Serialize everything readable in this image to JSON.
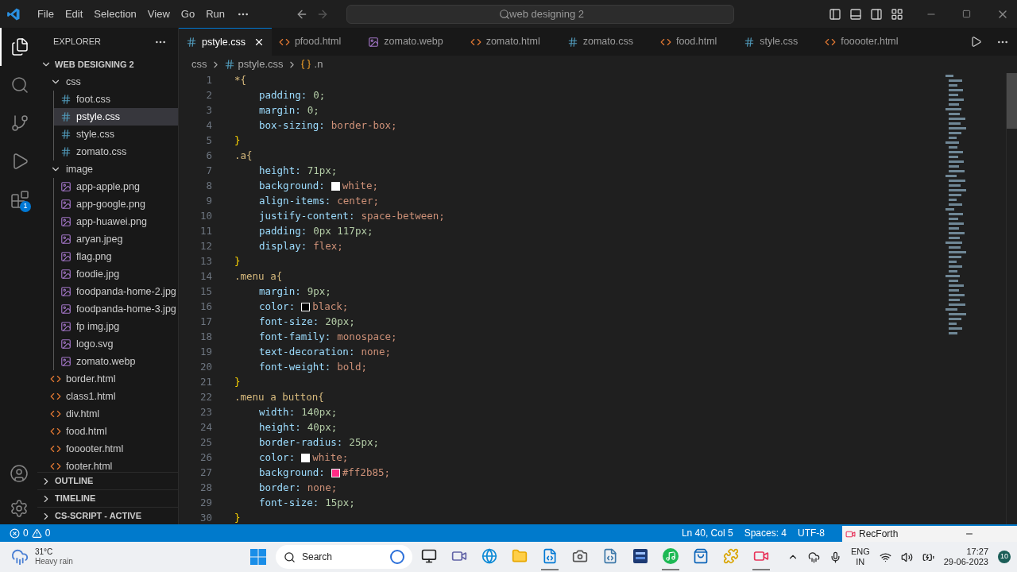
{
  "menu": [
    "File",
    "Edit",
    "Selection",
    "View",
    "Go",
    "Run"
  ],
  "command_center": {
    "placeholder": "web designing 2"
  },
  "activity_bar": [
    {
      "kind": "explorer",
      "selected": true
    },
    {
      "kind": "search",
      "selected": false
    },
    {
      "kind": "source-control",
      "selected": false
    },
    {
      "kind": "run-debug",
      "selected": false
    },
    {
      "kind": "extensions",
      "selected": false,
      "badge": "1"
    }
  ],
  "sidebar": {
    "title": "EXPLORER",
    "root": "WEB DESIGNING 2",
    "tree": [
      {
        "label": "css",
        "kind": "folder",
        "expanded": true,
        "selected": false,
        "children": [
          {
            "label": "foot.css",
            "kind": "css",
            "selected": false
          },
          {
            "label": "pstyle.css",
            "kind": "css",
            "selected": true
          },
          {
            "label": "style.css",
            "kind": "css",
            "selected": false
          },
          {
            "label": "zomato.css",
            "kind": "css",
            "selected": false
          }
        ]
      },
      {
        "label": "image",
        "kind": "folder",
        "expanded": true,
        "selected": false,
        "children": [
          {
            "label": "app-apple.png",
            "kind": "image",
            "selected": false
          },
          {
            "label": "app-google.png",
            "kind": "image",
            "selected": false
          },
          {
            "label": "app-huawei.png",
            "kind": "image",
            "selected": false
          },
          {
            "label": "aryan.jpeg",
            "kind": "image",
            "selected": false
          },
          {
            "label": "flag.png",
            "kind": "image",
            "selected": false
          },
          {
            "label": "foodie.jpg",
            "kind": "image",
            "selected": false
          },
          {
            "label": "foodpanda-home-2.jpg",
            "kind": "image",
            "selected": false
          },
          {
            "label": "foodpanda-home-3.jpg",
            "kind": "image",
            "selected": false
          },
          {
            "label": "fp img.jpg",
            "kind": "image",
            "selected": false
          },
          {
            "label": "logo.svg",
            "kind": "svg",
            "selected": false
          },
          {
            "label": "zomato.webp",
            "kind": "image",
            "selected": false
          }
        ]
      },
      {
        "label": "border.html",
        "kind": "html",
        "selected": false
      },
      {
        "label": "class1.html",
        "kind": "html",
        "selected": false
      },
      {
        "label": "div.html",
        "kind": "html",
        "selected": false
      },
      {
        "label": "food.html",
        "kind": "html",
        "selected": false
      },
      {
        "label": "fooooter.html",
        "kind": "html",
        "selected": false
      },
      {
        "label": "footer.html",
        "kind": "html",
        "selected": false
      }
    ],
    "panels": [
      {
        "label": "OUTLINE",
        "expanded": false
      },
      {
        "label": "TIMELINE",
        "expanded": false
      },
      {
        "label": "CS-SCRIPT - ACTIVE",
        "expanded": false
      }
    ]
  },
  "tabs": [
    {
      "label": "pstyle.css",
      "kind": "css",
      "selected": true
    },
    {
      "label": "pfood.html",
      "kind": "html",
      "selected": false
    },
    {
      "label": "zomato.webp",
      "kind": "image",
      "selected": false
    },
    {
      "label": "zomato.html",
      "kind": "html",
      "selected": false
    },
    {
      "label": "zomato.css",
      "kind": "css",
      "selected": false
    },
    {
      "label": "food.html",
      "kind": "html",
      "selected": false
    },
    {
      "label": "style.css",
      "kind": "css",
      "selected": false
    },
    {
      "label": "fooooter.html",
      "kind": "html",
      "selected": false
    }
  ],
  "breadcrumb": [
    {
      "label": "css",
      "kind": "folder"
    },
    {
      "label": "pstyle.css",
      "kind": "css"
    },
    {
      "label": ".n",
      "kind": "symbol"
    }
  ],
  "code": [
    {
      "n": "1",
      "kind": "selector",
      "text": "*{"
    },
    {
      "n": "2",
      "kind": "decl",
      "property": "padding:",
      "value": {
        "text": "0;",
        "kind": "number"
      }
    },
    {
      "n": "3",
      "kind": "decl",
      "property": "margin:",
      "value": {
        "text": "0;",
        "kind": "number"
      }
    },
    {
      "n": "4",
      "kind": "decl",
      "property": "box-sizing:",
      "value": {
        "text": "border-box;",
        "kind": "keyword"
      }
    },
    {
      "n": "5",
      "kind": "close",
      "text": "}"
    },
    {
      "n": "6",
      "kind": "selector",
      "text": ".a{"
    },
    {
      "n": "7",
      "kind": "decl",
      "property": "height:",
      "value": {
        "text": "71px;",
        "kind": "number"
      }
    },
    {
      "n": "8",
      "kind": "decl",
      "property": "background:",
      "value": {
        "text": "white;",
        "kind": "keyword"
      },
      "color": "#ffffff"
    },
    {
      "n": "9",
      "kind": "decl",
      "property": "align-items:",
      "value": {
        "text": "center;",
        "kind": "keyword"
      }
    },
    {
      "n": "10",
      "kind": "decl",
      "property": "justify-content:",
      "value": {
        "text": "space-between;",
        "kind": "keyword"
      }
    },
    {
      "n": "11",
      "kind": "decl",
      "property": "padding:",
      "value": {
        "text": "0px 117px;",
        "kind": "number"
      }
    },
    {
      "n": "12",
      "kind": "decl",
      "property": "display:",
      "value": {
        "text": "flex;",
        "kind": "keyword"
      }
    },
    {
      "n": "13",
      "kind": "close",
      "text": "}"
    },
    {
      "n": "14",
      "kind": "selector",
      "text": ".menu a{"
    },
    {
      "n": "15",
      "kind": "decl",
      "property": "margin:",
      "value": {
        "text": "9px;",
        "kind": "number"
      }
    },
    {
      "n": "16",
      "kind": "decl",
      "property": "color:",
      "value": {
        "text": "black;",
        "kind": "keyword"
      },
      "color": "#000000"
    },
    {
      "n": "17",
      "kind": "decl",
      "property": "font-size:",
      "value": {
        "text": "20px;",
        "kind": "number"
      }
    },
    {
      "n": "18",
      "kind": "decl",
      "property": "font-family:",
      "value": {
        "text": "monospace;",
        "kind": "keyword"
      }
    },
    {
      "n": "19",
      "kind": "decl",
      "property": "text-decoration:",
      "value": {
        "text": "none;",
        "kind": "keyword"
      }
    },
    {
      "n": "20",
      "kind": "decl",
      "property": "font-weight:",
      "value": {
        "text": "bold;",
        "kind": "keyword"
      }
    },
    {
      "n": "21",
      "kind": "close",
      "text": "}"
    },
    {
      "n": "22",
      "kind": "selector",
      "text": ".menu a button{"
    },
    {
      "n": "23",
      "kind": "decl",
      "property": "width:",
      "value": {
        "text": "140px;",
        "kind": "number"
      }
    },
    {
      "n": "24",
      "kind": "decl",
      "property": "height:",
      "value": {
        "text": "40px;",
        "kind": "number"
      }
    },
    {
      "n": "25",
      "kind": "decl",
      "property": "border-radius:",
      "value": {
        "text": "25px;",
        "kind": "number"
      }
    },
    {
      "n": "26",
      "kind": "decl",
      "property": "color:",
      "value": {
        "text": "white;",
        "kind": "keyword"
      },
      "color": "#ffffff"
    },
    {
      "n": "27",
      "kind": "decl",
      "property": "background:",
      "value": {
        "text": "#ff2b85;",
        "kind": "keyword"
      },
      "color": "#ff2b85"
    },
    {
      "n": "28",
      "kind": "decl",
      "property": "border:",
      "value": {
        "text": "none;",
        "kind": "keyword"
      }
    },
    {
      "n": "29",
      "kind": "decl",
      "property": "font-size:",
      "value": {
        "text": "15px;",
        "kind": "number"
      }
    },
    {
      "n": "30",
      "kind": "close",
      "text": "}"
    }
  ],
  "status_bar": {
    "errors": "0",
    "warnings": "0",
    "items": [
      "Ln 40, Col 5",
      "Spaces: 4",
      "UTF-8"
    ]
  },
  "recorder_window": {
    "title": "RecForth"
  },
  "taskbar": {
    "weather": {
      "temp": "31°C",
      "condition": "Heavy rain"
    },
    "search": "Search",
    "apps": [
      {
        "kind": "files",
        "running": false
      },
      {
        "kind": "meet",
        "running": false
      },
      {
        "kind": "edge",
        "running": false
      },
      {
        "kind": "folder",
        "running": false
      },
      {
        "kind": "vscode",
        "running": true
      },
      {
        "kind": "camera",
        "running": false
      },
      {
        "kind": "python",
        "running": false
      },
      {
        "kind": "dev",
        "running": false
      },
      {
        "kind": "spotify",
        "running": true
      },
      {
        "kind": "store",
        "running": false
      },
      {
        "kind": "puzzle",
        "running": false
      },
      {
        "kind": "recorder",
        "running": true
      }
    ],
    "language": [
      "ENG",
      "IN"
    ],
    "time": "17:27",
    "date": "29-06-2023",
    "notifications": "10"
  }
}
